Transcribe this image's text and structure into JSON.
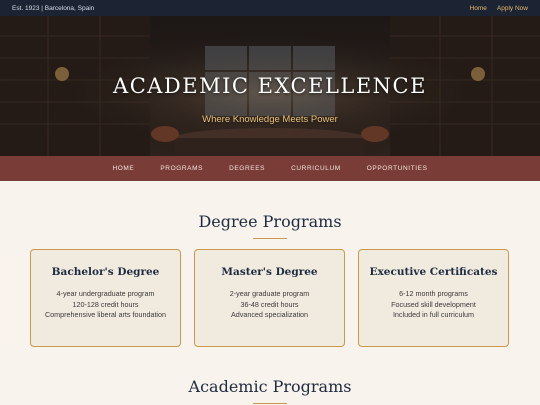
{
  "topbar": {
    "info": "Est. 1923 | Barcelona, Spain",
    "links": [
      "Home",
      "Apply Now"
    ]
  },
  "hero": {
    "title": "ACADEMIC EXCELLENCE",
    "subtitle": "Where Knowledge Meets Power"
  },
  "nav": {
    "items": [
      "HOME",
      "PROGRAMS",
      "DEGREES",
      "CURRICULUM",
      "OPPORTUNITIES"
    ]
  },
  "degrees": {
    "title": "Degree Programs",
    "cards": [
      {
        "title": "Bachelor's Degree",
        "lines": [
          "4-year undergraduate program",
          "120-128 credit hours",
          "Comprehensive liberal arts foundation"
        ]
      },
      {
        "title": "Master's Degree",
        "lines": [
          "2-year graduate program",
          "36-48 credit hours",
          "Advanced specialization"
        ]
      },
      {
        "title": "Executive Certificates",
        "lines": [
          "6-12 month programs",
          "Focused skill development",
          "Included in full curriculum"
        ]
      }
    ]
  },
  "academic": {
    "title": "Academic Programs"
  },
  "colors": {
    "topbar": "#1c2434",
    "nav": "#7a3c36",
    "accent": "#c89a4e",
    "heading": "#1e2b40",
    "background": "#f8f3ec"
  }
}
